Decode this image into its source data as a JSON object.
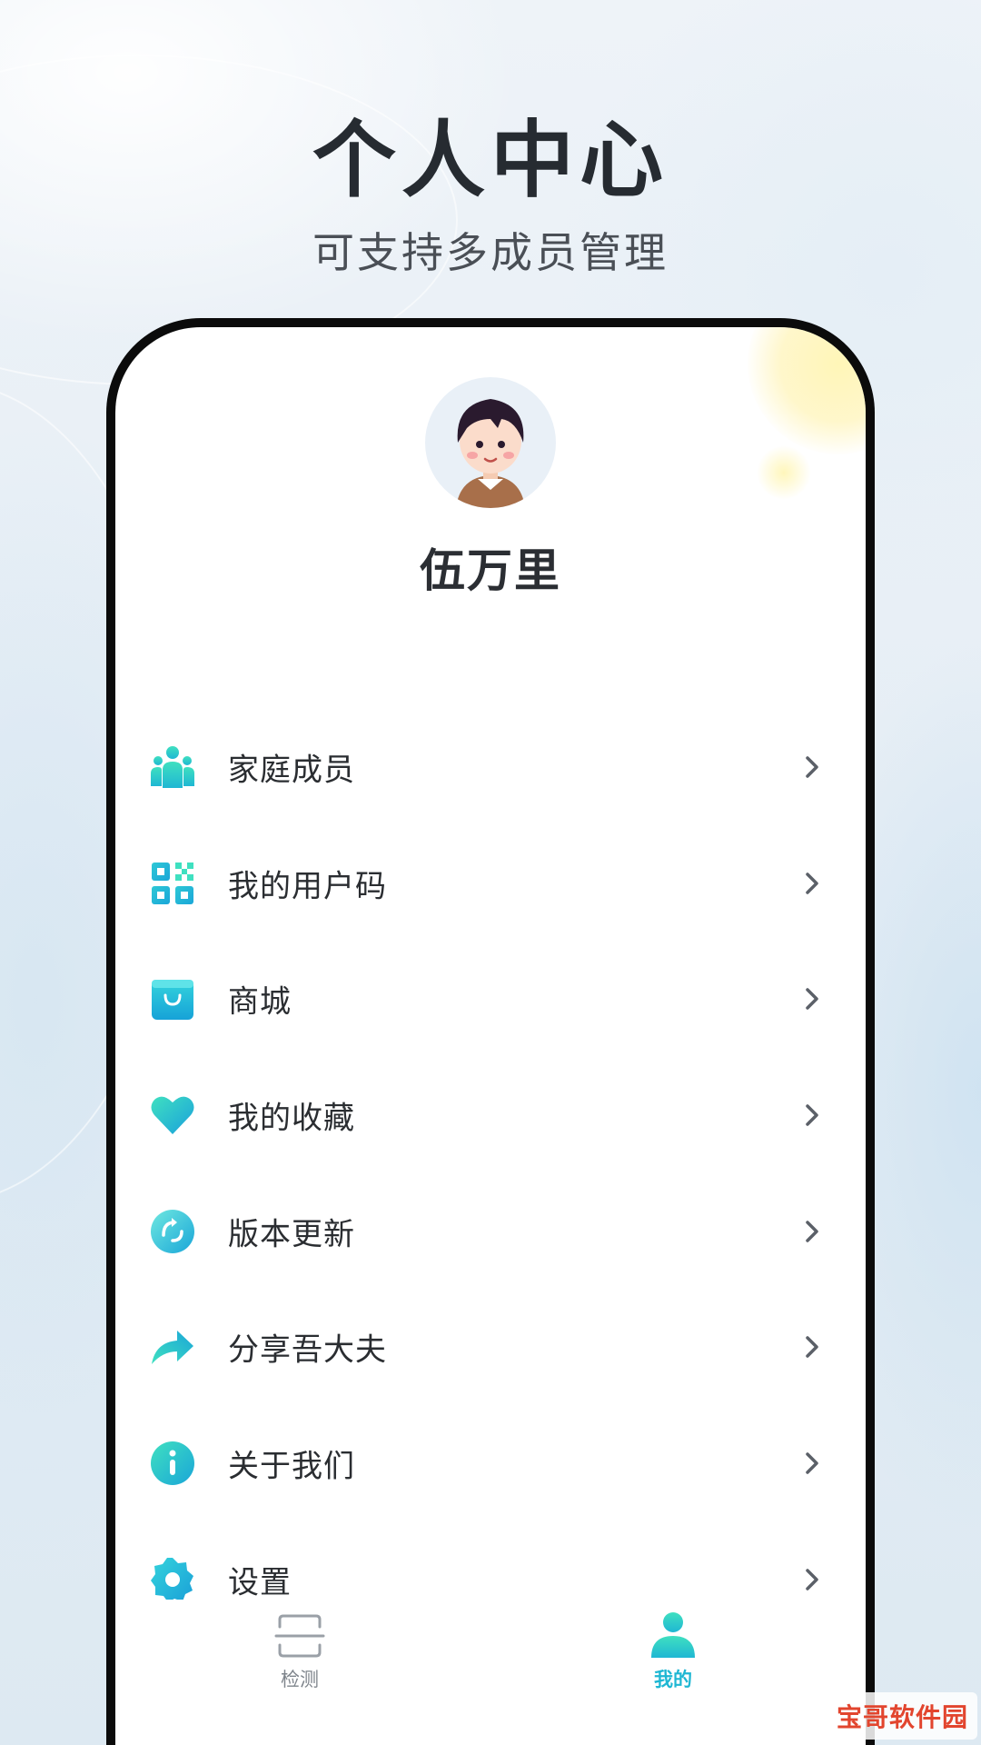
{
  "promo": {
    "title": "个人中心",
    "subtitle": "可支持多成员管理"
  },
  "profile": {
    "name": "伍万里",
    "avatar_icon": "boy-avatar-icon"
  },
  "menu": {
    "items": [
      {
        "label": "家庭成员",
        "icon": "family-members-icon"
      },
      {
        "label": "我的用户码",
        "icon": "qr-code-icon"
      },
      {
        "label": "商城",
        "icon": "shopping-bag-icon"
      },
      {
        "label": "我的收藏",
        "icon": "heart-icon"
      },
      {
        "label": "版本更新",
        "icon": "refresh-icon"
      },
      {
        "label": "分享吾大夫",
        "icon": "share-arrow-icon"
      },
      {
        "label": "关于我们",
        "icon": "info-icon"
      },
      {
        "label": "设置",
        "icon": "gear-icon"
      }
    ]
  },
  "tabbar": {
    "tabs": [
      {
        "label": "检测",
        "icon": "scan-icon",
        "active": false
      },
      {
        "label": "我的",
        "icon": "user-icon",
        "active": true
      }
    ]
  },
  "watermark": {
    "text": "宝哥软件园"
  },
  "colors": {
    "accent": "#1fb7d3",
    "accent_light": "#3fe0c0",
    "text": "#2a2d31"
  }
}
